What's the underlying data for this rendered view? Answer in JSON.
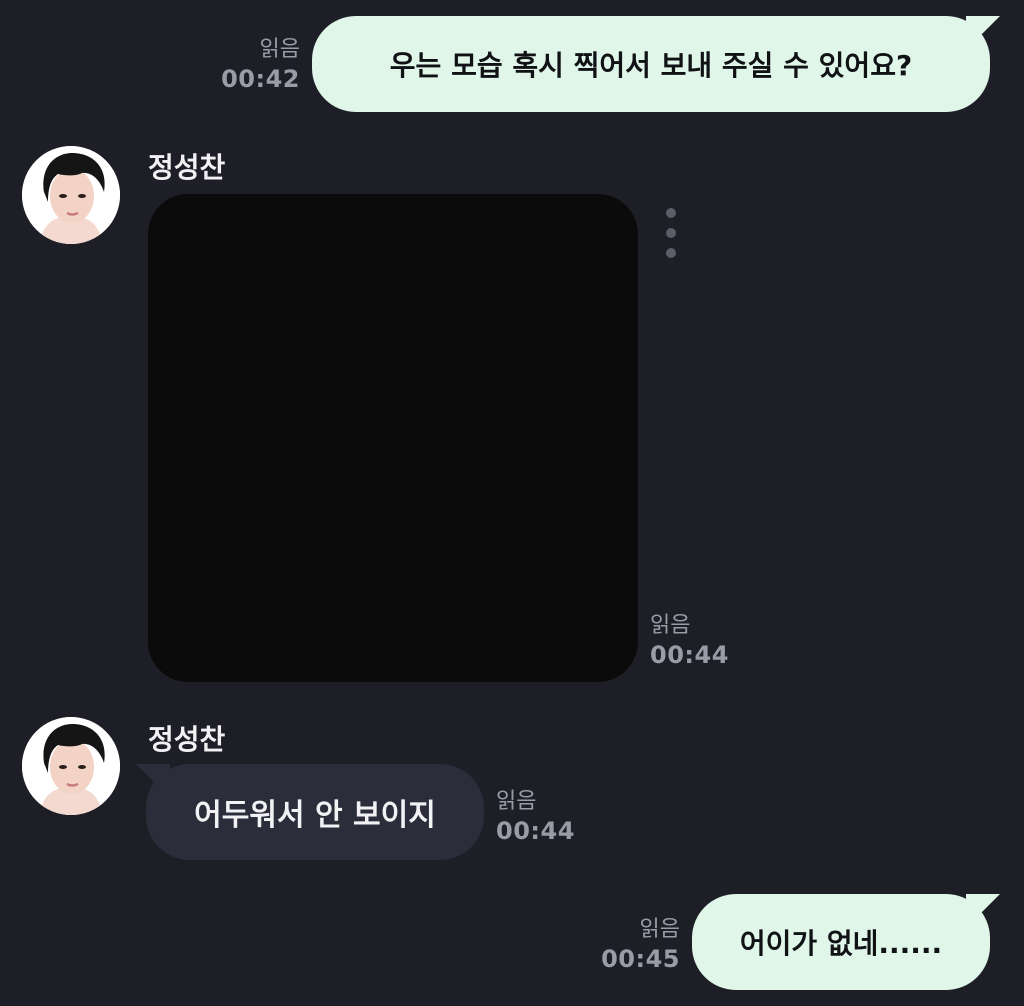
{
  "messages": [
    {
      "direction": "outgoing",
      "text": "우는 모습 혹시 찍어서 보내 주실 수 있어요?",
      "read": "읽음",
      "time": "00:42"
    },
    {
      "direction": "incoming",
      "sender": "정성찬",
      "type": "photo",
      "read": "읽음",
      "time": "00:44"
    },
    {
      "direction": "incoming",
      "sender": "정성찬",
      "text": "어두워서 안 보이지",
      "read": "읽음",
      "time": "00:44"
    },
    {
      "direction": "outgoing",
      "text": "어이가 없네......",
      "read": "읽음",
      "time": "00:45"
    }
  ],
  "colors": {
    "background": "#1e1f26",
    "outgoing_bubble": "#dff6e8",
    "incoming_bubble": "#2b2d3a",
    "meta_text": "#9a9ba6",
    "photo": "#0b0b0c"
  },
  "icons": {
    "more": "vertical-ellipsis-icon"
  }
}
